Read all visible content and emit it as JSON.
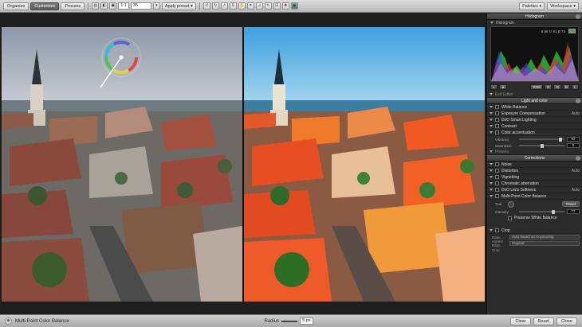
{
  "toolbar": {
    "tabs": [
      "Organize",
      "Customize",
      "Process"
    ],
    "zoom_ratio": "1:1",
    "zoom_value": "35",
    "apply_preset": "Apply preset",
    "palettes": "Palettes",
    "workspace": "Workspace"
  },
  "panel": {
    "histogram_title": "Histogram",
    "histogram_label": "Histogram",
    "histogram_values": "8.86 G 91 B 73",
    "channels": [
      "RGB",
      "R",
      "G",
      "B",
      "L"
    ],
    "exif_editor": "Exif Editor",
    "light_color_title": "Light and color",
    "light_items": [
      {
        "label": "White Balance",
        "auto": ""
      },
      {
        "label": "Exposure Compensation",
        "auto": "Auto"
      },
      {
        "label": "DxO Smart Lighting",
        "auto": ""
      },
      {
        "label": "Contrast",
        "auto": ""
      },
      {
        "label": "Color accentuation",
        "auto": ""
      }
    ],
    "vibrancy_label": "Vibrancy",
    "vibrancy_value": "92",
    "vibrancy": 0.92,
    "saturation_label": "Saturation",
    "saturation_value": "0",
    "saturation": 0.5,
    "presets": "Presets",
    "corrections_title": "Corrections",
    "correction_items": [
      {
        "label": "Noise",
        "auto": ""
      },
      {
        "label": "Distortion",
        "auto": "Auto"
      },
      {
        "label": "Vignetting",
        "auto": ""
      },
      {
        "label": "Chromatic aberration",
        "auto": ""
      },
      {
        "label": "DxO Lens Softness",
        "auto": "Auto"
      },
      {
        "label": "Multi-Point Color Balance",
        "auto": ""
      }
    ],
    "tool_label": "Tool",
    "reset_label": "Reset",
    "intensity_label": "Intensity",
    "intensity_value": "77",
    "intensity": 0.77,
    "preserve_wb": "Preserve White Balance",
    "crop_title": "Crop",
    "crop_ratio_label": "Ratio",
    "crop_ratio_value": "Auto based on Keystoning",
    "crop_aspect_label": "Aspect Ratio",
    "crop_aspect_value": "Original",
    "crop_hint_label": "Crop"
  },
  "status": {
    "tool_name": "Multi-Point Color Balance",
    "radius_label": "Radius",
    "radius_value": "5 px",
    "clear": "Clear",
    "reset": "Reset",
    "close": "Close"
  }
}
